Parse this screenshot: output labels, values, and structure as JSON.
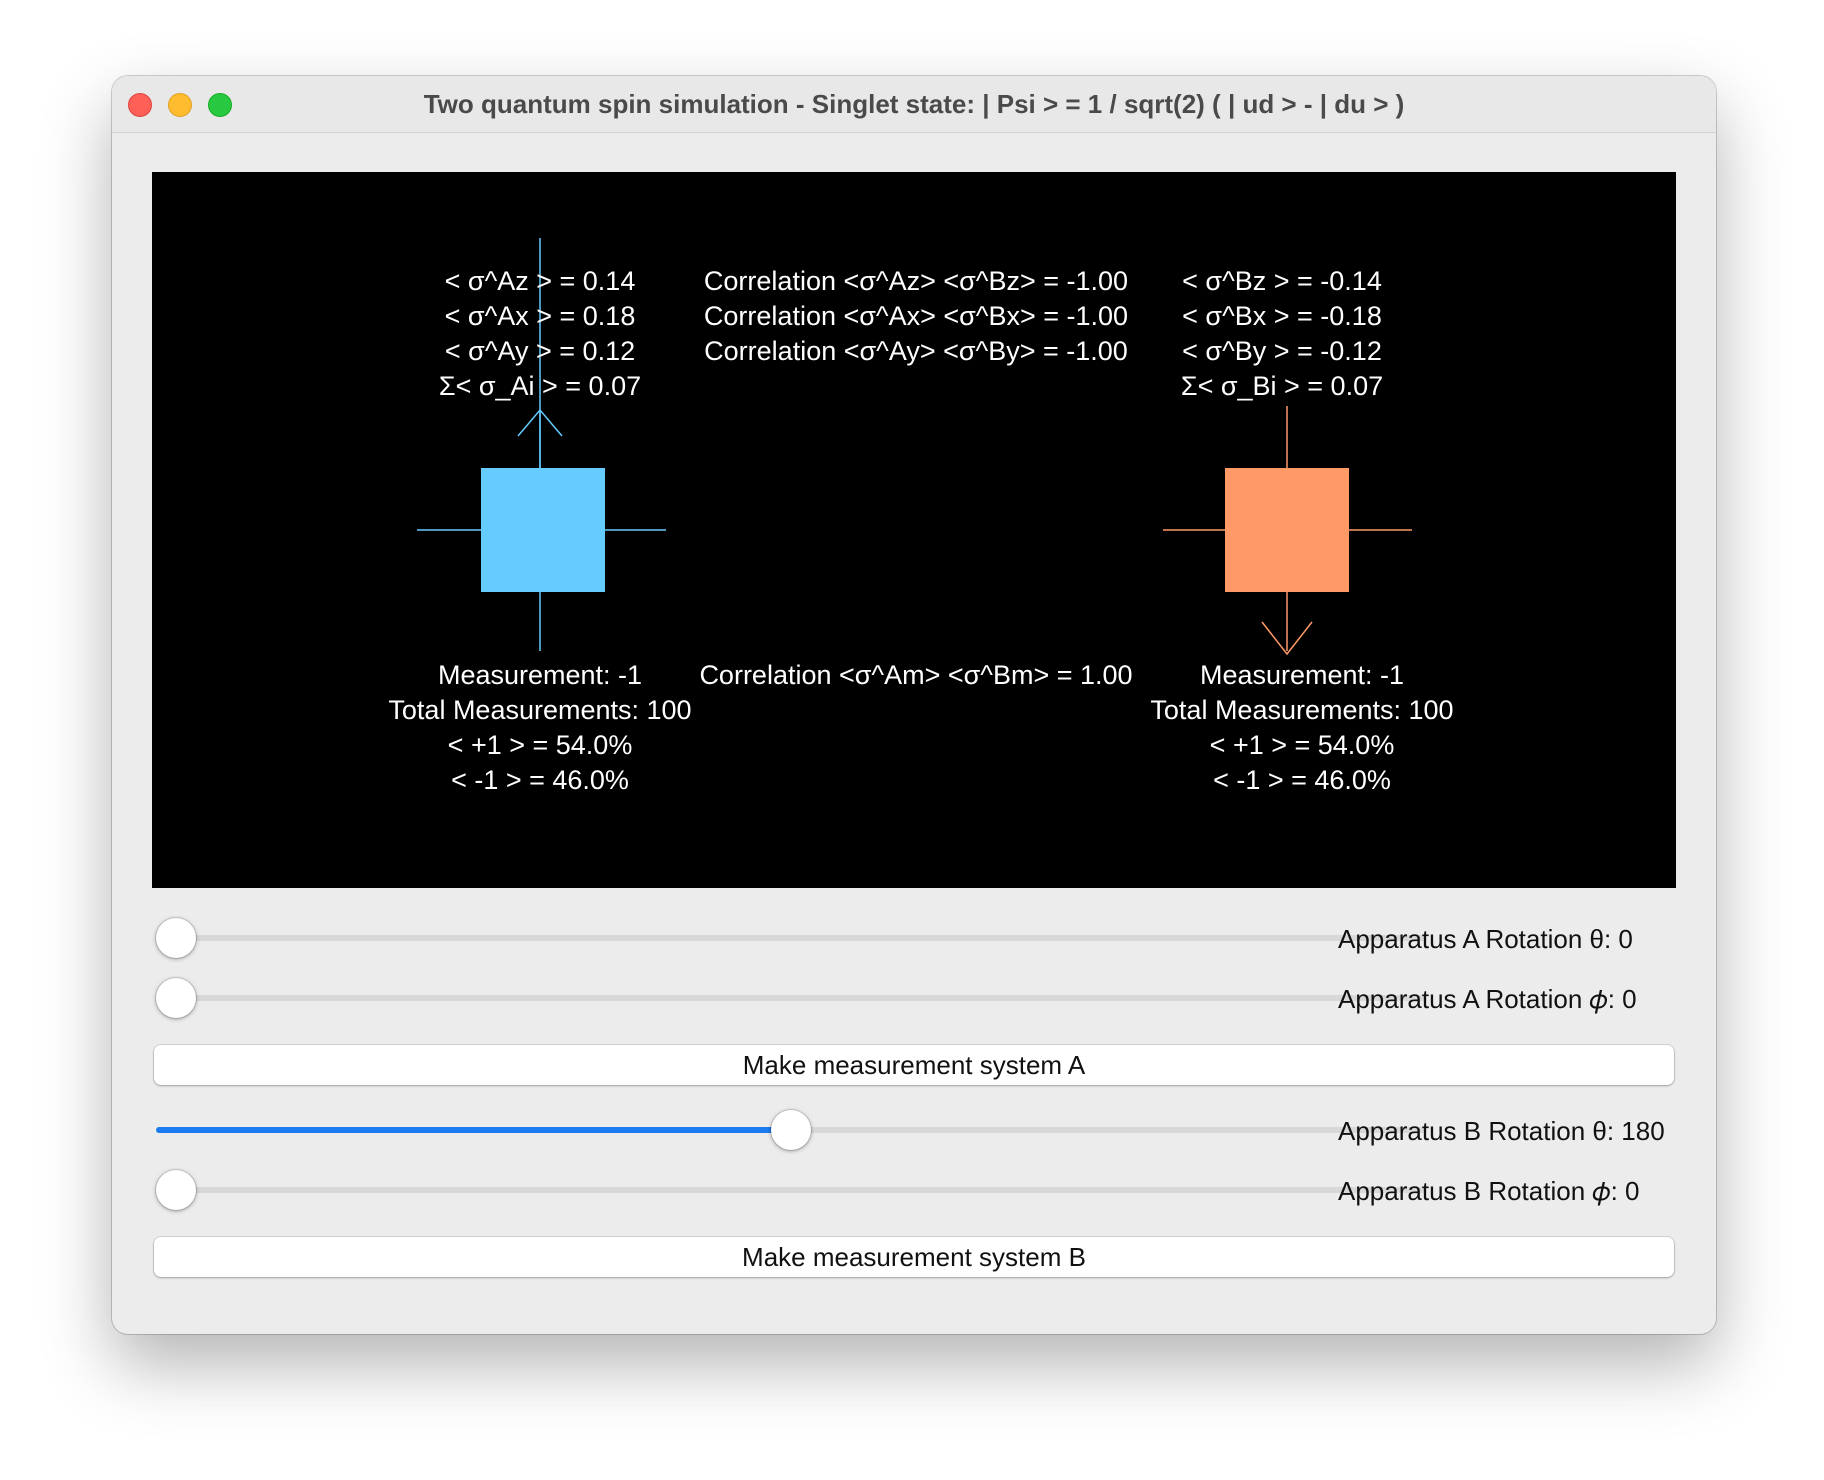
{
  "window": {
    "title": "Two quantum spin simulation - Singlet state: | Psi > = 1 / sqrt(2) ( | ud > - | du > )"
  },
  "system_a": {
    "color": "#66ccff",
    "expectations": [
      "< σ^Az > = 0.14",
      "< σ^Ax > = 0.18",
      "< σ^Ay > = 0.12",
      "Σ< σ_Ai > = 0.07"
    ],
    "measurement": "Measurement: -1",
    "total": "Total Measurements: 100",
    "plus": "< +1 > = 54.0%",
    "minus": "< -1 > = 46.0%",
    "arrow": "up-arrow"
  },
  "system_b": {
    "color": "#ff9966",
    "expectations": [
      "< σ^Bz > = -0.14",
      "< σ^Bx > = -0.18",
      "< σ^By > = -0.12",
      "Σ< σ_Bi > = 0.07"
    ],
    "measurement": "Measurement: -1",
    "total": "Total Measurements: 100",
    "plus": "< +1 > = 54.0%",
    "minus": "< -1 > = 46.0%",
    "arrow": "down-arrow"
  },
  "correlations": {
    "z": "Correlation <σ^Az> <σ^Bz> = -1.00",
    "x": "Correlation <σ^Ax> <σ^Bx> = -1.00",
    "y": "Correlation <σ^Ay> <σ^By> = -1.00",
    "m": "Correlation <σ^Am> <σ^Bm> = 1.00"
  },
  "controls": {
    "a_theta_label": "Apparatus A Rotation θ: 0",
    "a_theta_value": 0,
    "a_phi_label": "Apparatus A Rotation 𝜙: 0",
    "a_phi_value": 0,
    "measure_a": "Make measurement system A",
    "b_theta_label": "Apparatus B Rotation θ: 180",
    "b_theta_value": 180,
    "b_phi_label": "Apparatus B Rotation 𝜙: 0",
    "b_phi_value": 0,
    "measure_b": "Make measurement system B",
    "accent": "#1a7cf0"
  }
}
